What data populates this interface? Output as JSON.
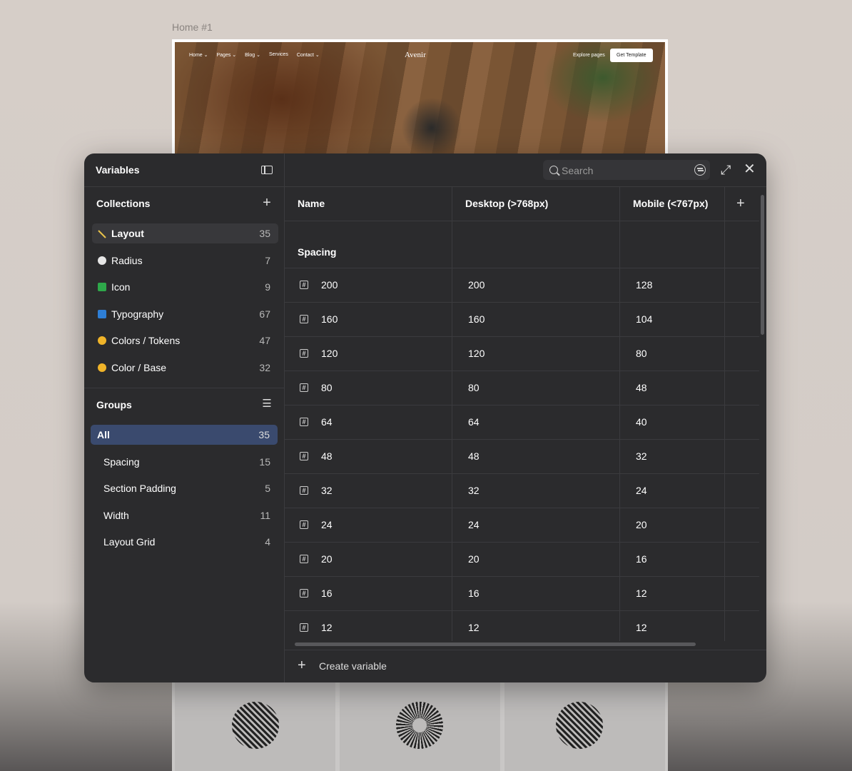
{
  "canvas": {
    "frame_label": "Home #1",
    "hero_nav": [
      "Home ⌄",
      "Pages ⌄",
      "Blog ⌄",
      "Services",
      "Contact ⌄"
    ],
    "hero_logo": "Avenir",
    "hero_link": "Explore pages",
    "hero_button": "Get Template"
  },
  "panel": {
    "title": "Variables",
    "search_placeholder": "Search",
    "collections_title": "Collections",
    "groups_title": "Groups",
    "collections": [
      {
        "label": "Layout",
        "count": "35",
        "icon": "ruler-icon",
        "color": "#e8c24a"
      },
      {
        "label": "Radius",
        "count": "7",
        "icon": "circle-icon",
        "color": "#e6e6e6"
      },
      {
        "label": "Icon",
        "count": "9",
        "icon": "icon-grid-icon",
        "color": "#2ea84a"
      },
      {
        "label": "Typography",
        "count": "67",
        "icon": "text-icon",
        "color": "#2e7fd6"
      },
      {
        "label": "Colors / Tokens",
        "count": "47",
        "icon": "palette-icon",
        "color": "#f0b429"
      },
      {
        "label": "Color / Base",
        "count": "32",
        "icon": "palette-icon",
        "color": "#f0b429"
      }
    ],
    "groups": [
      {
        "label": "All",
        "count": "35"
      },
      {
        "label": "Spacing",
        "count": "15"
      },
      {
        "label": "Section Padding",
        "count": "5"
      },
      {
        "label": "Width",
        "count": "11"
      },
      {
        "label": "Layout Grid",
        "count": "4"
      }
    ],
    "columns": {
      "name": "Name",
      "desktop": "Desktop (>768px)",
      "mobile": "Mobile (<767px)"
    },
    "group_label": "Spacing",
    "rows": [
      {
        "name": "200",
        "desktop": "200",
        "mobile": "128"
      },
      {
        "name": "160",
        "desktop": "160",
        "mobile": "104"
      },
      {
        "name": "120",
        "desktop": "120",
        "mobile": "80"
      },
      {
        "name": "80",
        "desktop": "80",
        "mobile": "48"
      },
      {
        "name": "64",
        "desktop": "64",
        "mobile": "40"
      },
      {
        "name": "48",
        "desktop": "48",
        "mobile": "32"
      },
      {
        "name": "32",
        "desktop": "32",
        "mobile": "24"
      },
      {
        "name": "24",
        "desktop": "24",
        "mobile": "20"
      },
      {
        "name": "20",
        "desktop": "20",
        "mobile": "16"
      },
      {
        "name": "16",
        "desktop": "16",
        "mobile": "12"
      },
      {
        "name": "12",
        "desktop": "12",
        "mobile": "12"
      }
    ],
    "create_label": "Create variable",
    "accent_color": "#3a4a6e"
  }
}
